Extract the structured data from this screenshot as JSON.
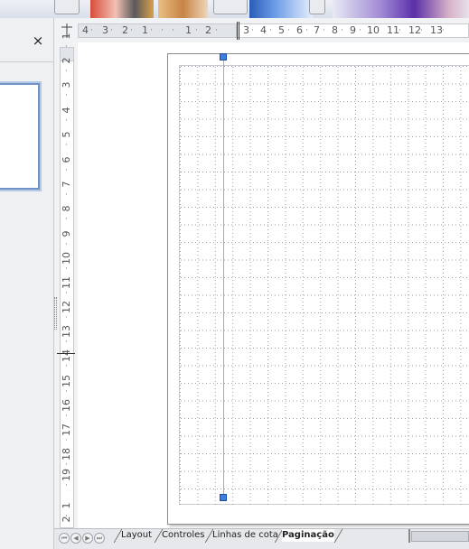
{
  "slide_panel": {
    "close_icon": "×"
  },
  "hruler": {
    "labels": [
      {
        "text": "4"
      },
      {
        "text": "3"
      },
      {
        "text": "2"
      },
      {
        "text": "1"
      },
      {
        "text": "1"
      },
      {
        "text": "2"
      },
      {
        "text": "3"
      },
      {
        "text": "4"
      },
      {
        "text": "5"
      },
      {
        "text": "6"
      },
      {
        "text": "7"
      },
      {
        "text": "8"
      },
      {
        "text": "9"
      },
      {
        "text": "10"
      },
      {
        "text": "11"
      },
      {
        "text": "12"
      },
      {
        "text": "13"
      }
    ]
  },
  "vruler": {
    "labels": [
      "1",
      "2",
      "3",
      "4",
      "5",
      "6",
      "7",
      "8",
      "9",
      "10",
      "11",
      "12",
      "13",
      "14",
      "15",
      "16",
      "17",
      "18",
      "19",
      "1",
      "2"
    ]
  },
  "tabs": [
    {
      "label": "Layout",
      "active": false
    },
    {
      "label": "Controles",
      "active": false
    },
    {
      "label": "Linhas de cota",
      "active": false
    },
    {
      "label": "Paginação",
      "active": true
    }
  ],
  "nav_buttons": [
    {
      "icon": "first-page-icon",
      "glyph": "⏮"
    },
    {
      "icon": "previous-page-icon",
      "glyph": "◀"
    },
    {
      "icon": "next-page-icon",
      "glyph": "▶"
    },
    {
      "icon": "last-page-icon",
      "glyph": "⏭"
    }
  ],
  "colors": {
    "guide_line": "#e89b5a",
    "handle": "#3d7ee0",
    "grid_dot": "#9aa0a8"
  }
}
